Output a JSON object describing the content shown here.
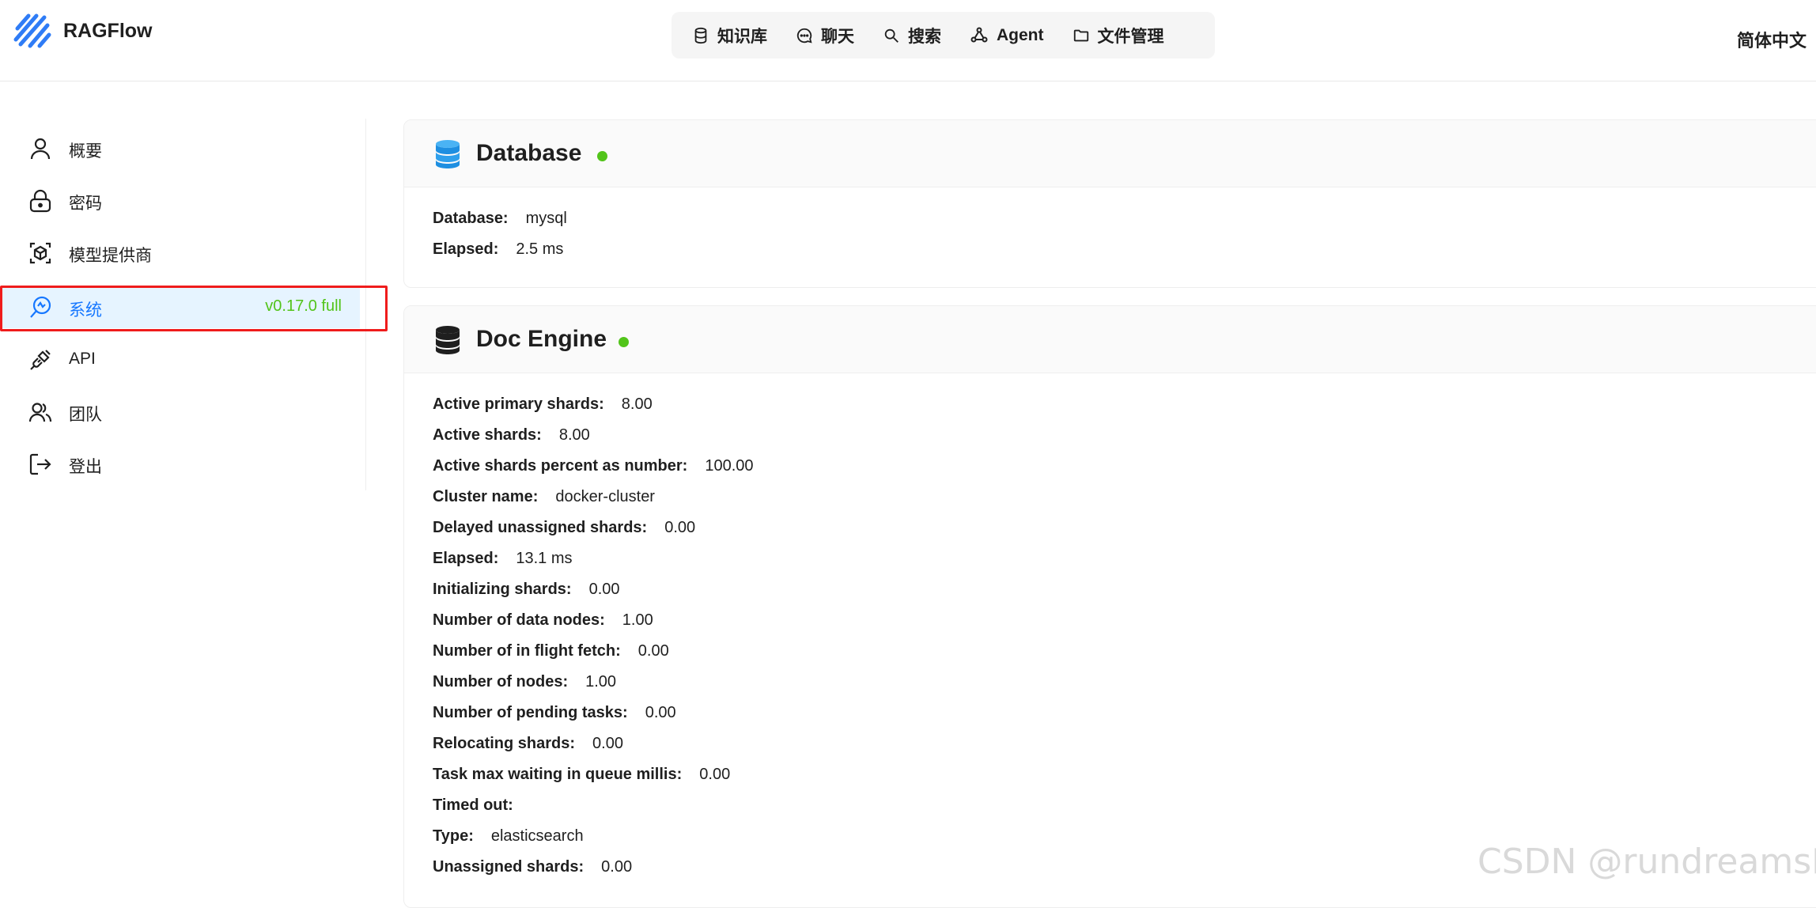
{
  "app": {
    "name": "RAGFlow"
  },
  "topnav": {
    "items": [
      {
        "label": "知识库",
        "icon": "database-icon"
      },
      {
        "label": "聊天",
        "icon": "chat-icon"
      },
      {
        "label": "搜索",
        "icon": "search-icon"
      },
      {
        "label": "Agent",
        "icon": "agent-icon"
      },
      {
        "label": "文件管理",
        "icon": "folder-icon"
      }
    ],
    "language": "简体中文"
  },
  "sidebar": {
    "items": [
      {
        "label": "概要",
        "icon": "user-icon"
      },
      {
        "label": "密码",
        "icon": "lock-icon"
      },
      {
        "label": "模型提供商",
        "icon": "model-icon"
      },
      {
        "label": "系统",
        "icon": "system-icon",
        "active": true,
        "badge": "v0.17.0 full"
      },
      {
        "label": "API",
        "icon": "plug-icon"
      },
      {
        "label": "团队",
        "icon": "team-icon"
      },
      {
        "label": "登出",
        "icon": "logout-icon"
      }
    ]
  },
  "colors": {
    "accent": "#1677ff",
    "active_bg": "#e6f4ff",
    "status_ok": "#52c41a",
    "highlight": "#ef1c1c"
  },
  "database": {
    "title": "Database",
    "rows": [
      {
        "key": "Database:",
        "value": "mysql"
      },
      {
        "key": "Elapsed:",
        "value": "2.5 ms"
      }
    ]
  },
  "doc_engine": {
    "title": "Doc Engine",
    "rows": [
      {
        "key": "Active primary shards:",
        "value": "8.00"
      },
      {
        "key": "Active shards:",
        "value": "8.00"
      },
      {
        "key": "Active shards percent as number:",
        "value": "100.00"
      },
      {
        "key": "Cluster name:",
        "value": "docker-cluster"
      },
      {
        "key": "Delayed unassigned shards:",
        "value": "0.00"
      },
      {
        "key": "Elapsed:",
        "value": "13.1 ms"
      },
      {
        "key": "Initializing shards:",
        "value": "0.00"
      },
      {
        "key": "Number of data nodes:",
        "value": "1.00"
      },
      {
        "key": "Number of in flight fetch:",
        "value": "0.00"
      },
      {
        "key": "Number of nodes:",
        "value": "1.00"
      },
      {
        "key": "Number of pending tasks:",
        "value": "0.00"
      },
      {
        "key": "Relocating shards:",
        "value": "0.00"
      },
      {
        "key": "Task max waiting in queue millis:",
        "value": "0.00"
      },
      {
        "key": "Timed out:",
        "value": ""
      },
      {
        "key": "Type:",
        "value": "elasticsearch"
      },
      {
        "key": "Unassigned shards:",
        "value": "0.00"
      }
    ]
  },
  "watermark": "CSDN @rundreamsFly"
}
